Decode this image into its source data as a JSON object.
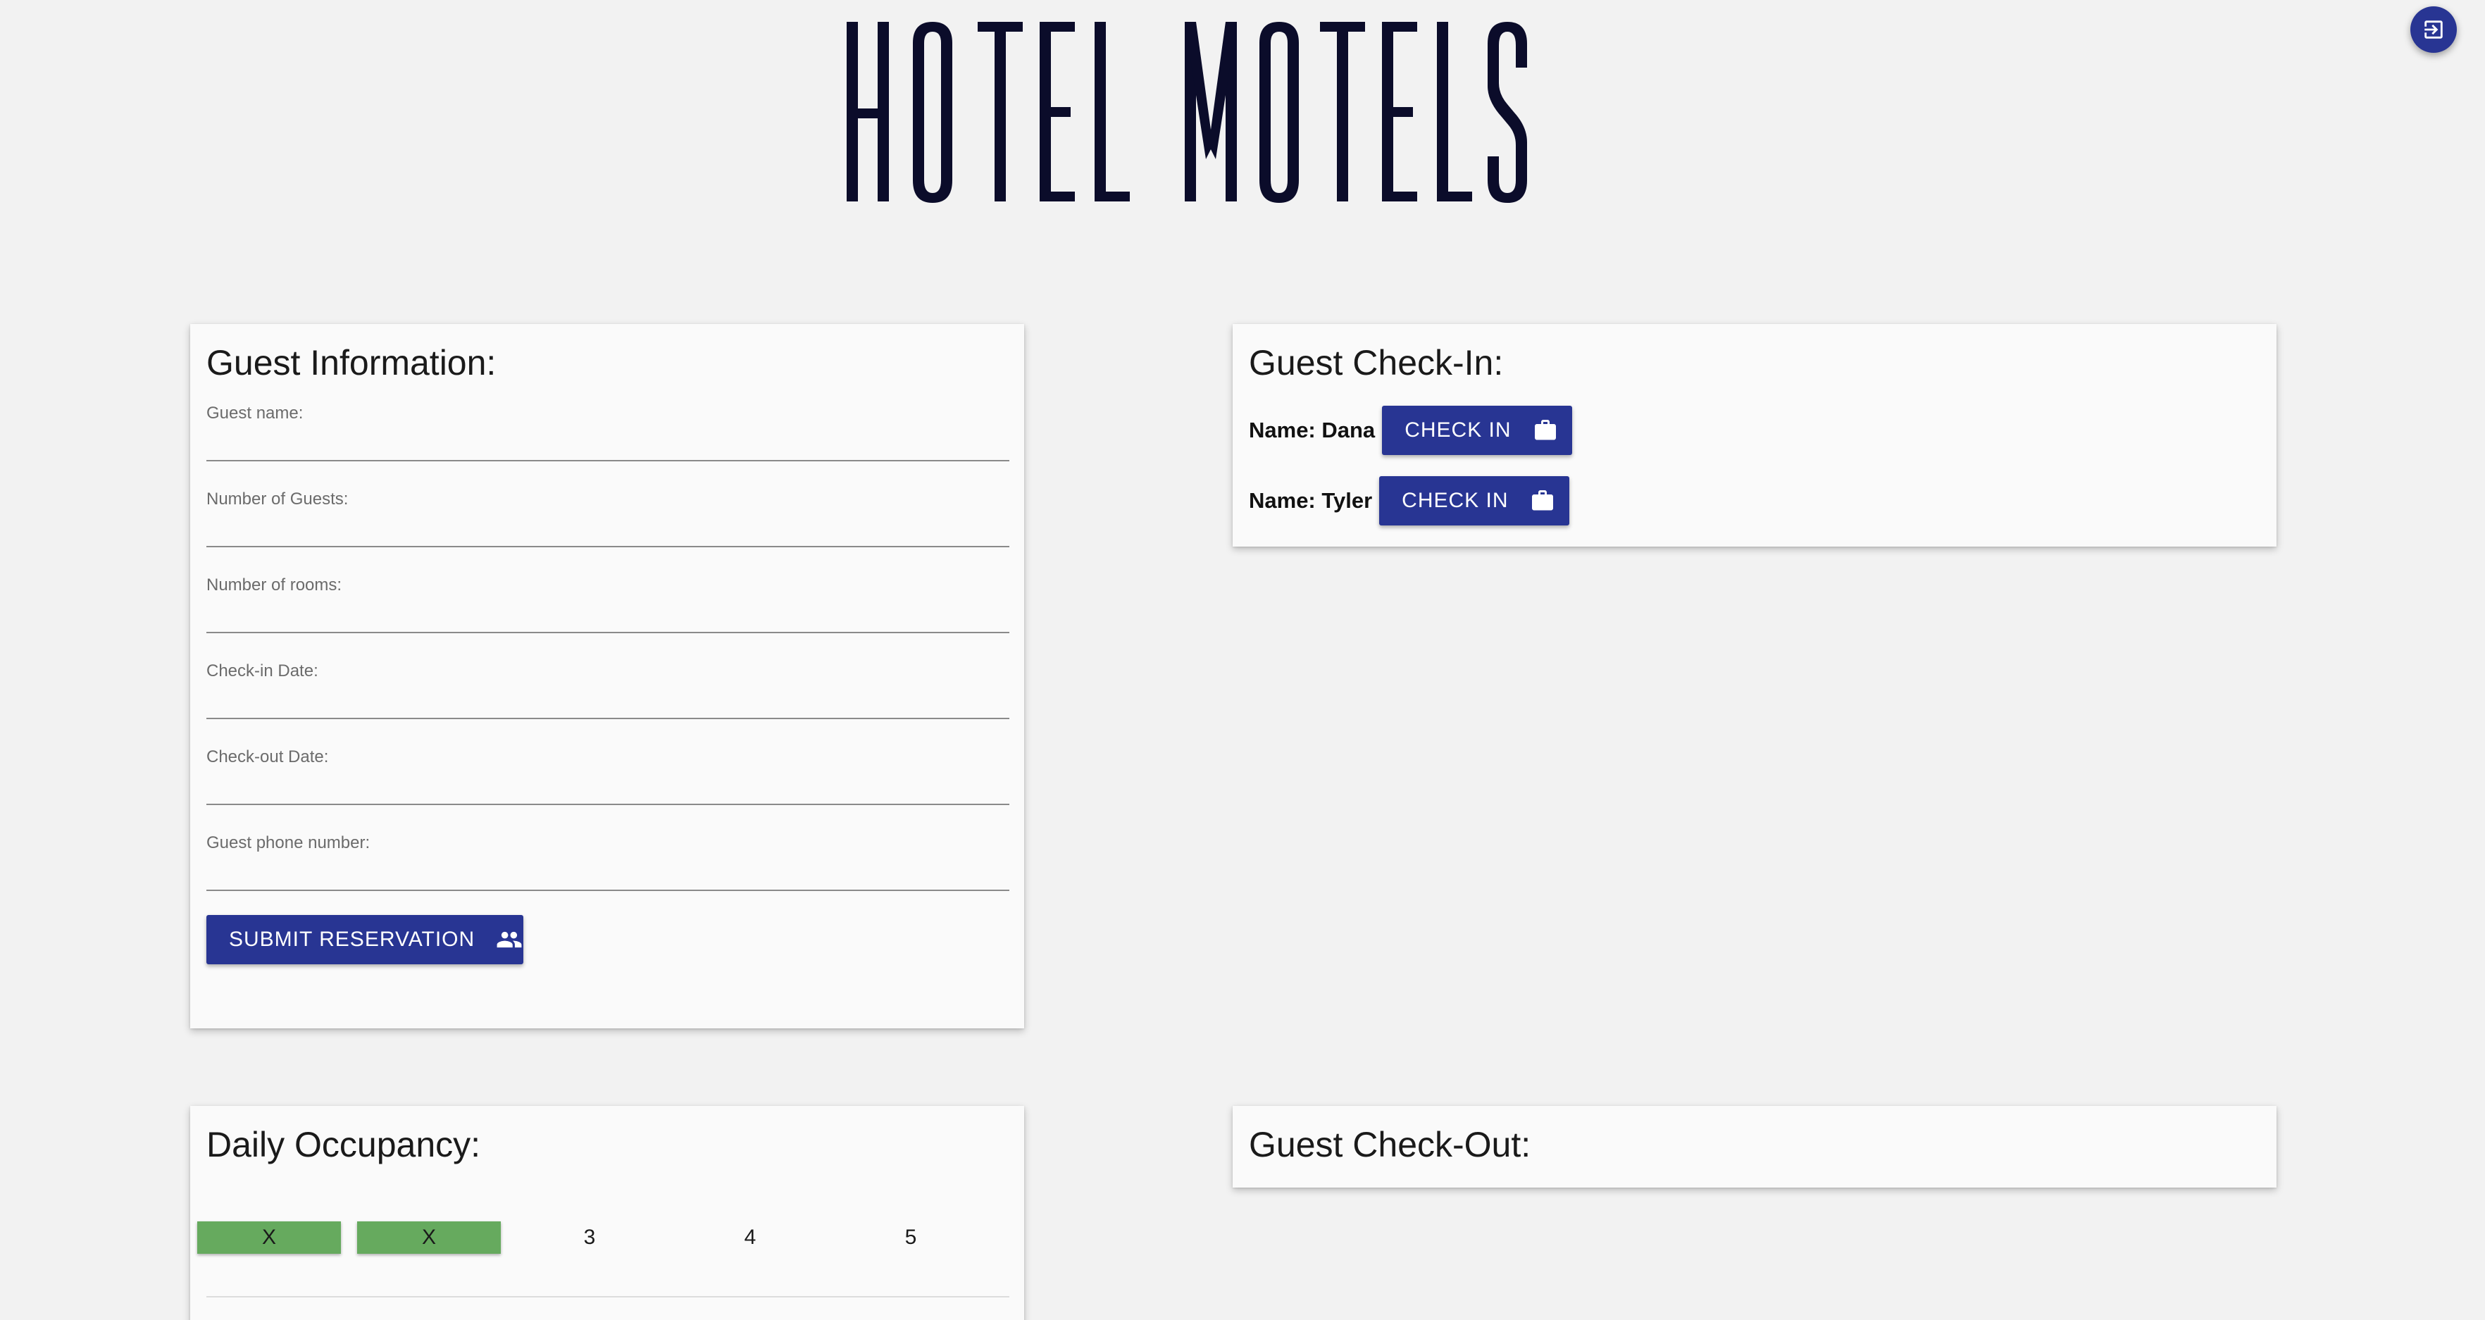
{
  "header": {
    "logo_text": "HOTEL MOTELS",
    "exit_icon": "exit-to-app-icon"
  },
  "colors": {
    "background": "#f2f2f2",
    "card": "#fafafa",
    "primary": "#283593",
    "occupied": "#66aa5e",
    "logo": "#0b0c2a"
  },
  "guest_info": {
    "title": "Guest Information:",
    "fields": [
      {
        "label": "Guest name:",
        "value": ""
      },
      {
        "label": "Number of Guests:",
        "value": ""
      },
      {
        "label": "Number of rooms:",
        "value": ""
      },
      {
        "label": "Check-in Date:",
        "value": ""
      },
      {
        "label": "Check-out Date:",
        "value": ""
      },
      {
        "label": "Guest phone number:",
        "value": ""
      }
    ],
    "submit_label": "SUBMIT RESERVATION",
    "submit_icon": "people-icon"
  },
  "check_in": {
    "title": "Guest Check-In:",
    "guests": [
      {
        "name": "Name: Dana",
        "button_label": "CHECK IN",
        "icon": "briefcase-icon"
      },
      {
        "name": "Name: Tyler",
        "button_label": "CHECK IN",
        "icon": "briefcase-icon"
      }
    ]
  },
  "occupancy": {
    "title": "Daily Occupancy:",
    "rooms": [
      {
        "label": "X",
        "occupied": true
      },
      {
        "label": "X",
        "occupied": true
      },
      {
        "label": "3",
        "occupied": false
      },
      {
        "label": "4",
        "occupied": false
      },
      {
        "label": "5",
        "occupied": false
      }
    ]
  },
  "check_out": {
    "title": "Guest Check-Out:"
  }
}
